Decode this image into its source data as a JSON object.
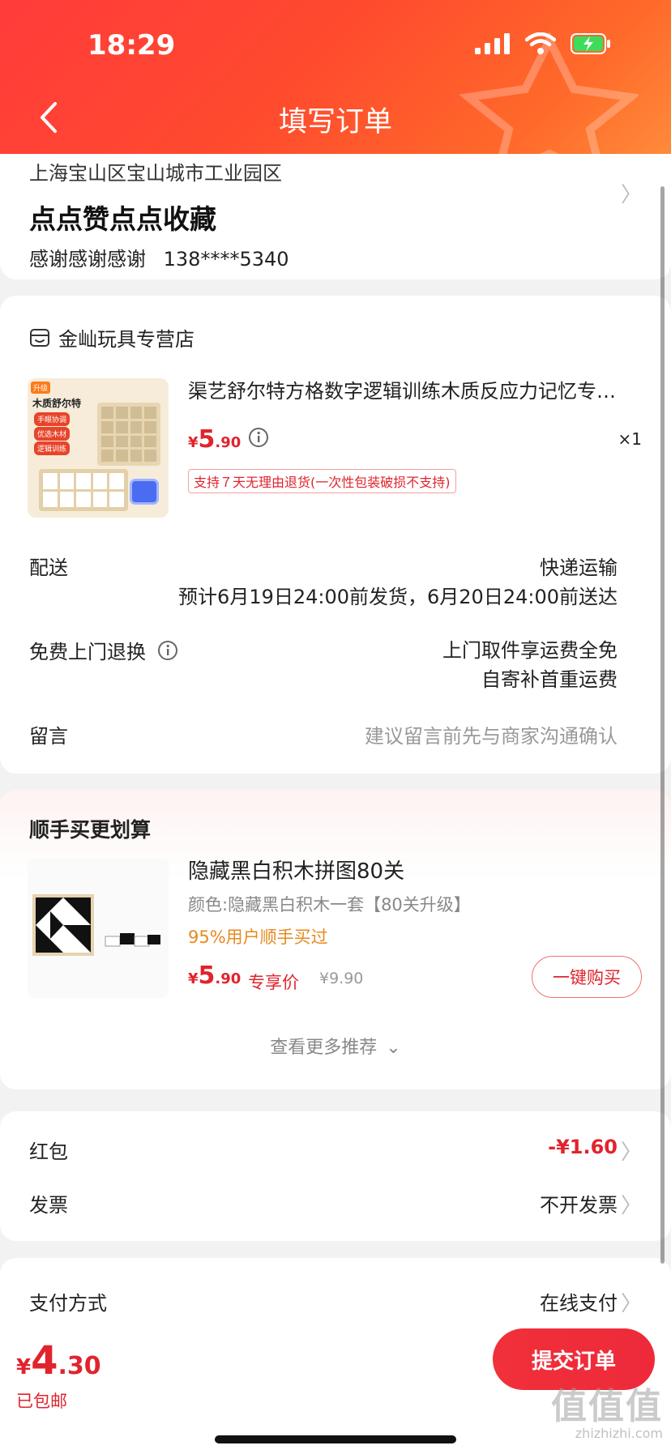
{
  "status_bar": {
    "time": "18:29"
  },
  "nav": {
    "title": "填写订单"
  },
  "address": {
    "line": "上海宝山区宝山城市工业园区",
    "name": "点点赞点点收藏",
    "contact_name": "感谢感谢感谢",
    "phone": "138****5340"
  },
  "order": {
    "store_name": "金屾玩具专营店",
    "product": {
      "title": "渠艺舒尔特方格数字逻辑训练木质反应力记忆专…",
      "price_symbol": "¥",
      "price_int": "5",
      "price_dec": ".90",
      "quantity": "×1",
      "return_policy": "支持７天无理由退货(一次性包装破损不支持)",
      "image_labels": [
        "升级",
        "木质舒尔特",
        "手眼协调",
        "优选木材",
        "逻辑训练"
      ]
    },
    "delivery": {
      "label": "配送",
      "method": "快递运输",
      "eta": "预计6月19日24:00前发货，6月20日24:00前送达"
    },
    "free_return": {
      "label": "免费上门退换",
      "line1": "上门取件享运费全免",
      "line2": "自寄补首重运费"
    },
    "message": {
      "label": "留言",
      "placeholder": "建议留言前先与商家沟通确认"
    }
  },
  "recommend": {
    "heading": "顺手买更划算",
    "item": {
      "title": "隐藏黑白积木拼图80关",
      "variant": "颜色:隐藏黑白积木一套【80关升级】",
      "bought": "95%用户顺手买过",
      "price_symbol": "¥",
      "price_int": "5",
      "price_dec": ".90",
      "exclusive": "专享价",
      "original_price": "¥9.90",
      "buy_label": "一键购买"
    },
    "more_label": "查看更多推荐"
  },
  "fees": {
    "red_packet_label": "红包",
    "red_packet_value": "-¥1.60",
    "invoice_label": "发票",
    "invoice_value": "不开发票",
    "payment_label": "支付方式",
    "payment_value": "在线支付"
  },
  "bottom": {
    "total_symbol": "¥",
    "total_int": "4",
    "total_dec": ".30",
    "shipping": "已包邮",
    "submit_label": "提交订单",
    "watermark": "值值值",
    "watermark_url": "zhizhizhi.com"
  },
  "colors": {
    "accent": "#e0242d",
    "header": "#ff4a2e",
    "bought": "#e58a1f"
  }
}
